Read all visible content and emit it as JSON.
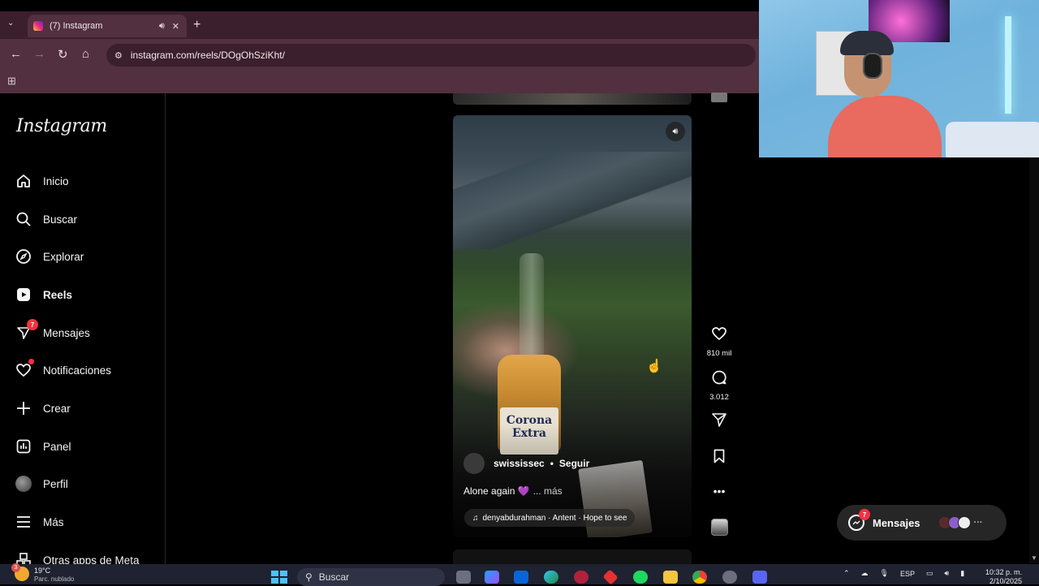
{
  "browser": {
    "tab_title": "(7) Instagram",
    "url": "instagram.com/reels/DOgOhSziKht/",
    "icons": [
      "tab-search-icon",
      "audio-icon",
      "close-icon",
      "new-tab-icon",
      "back-icon",
      "forward-icon",
      "reload-icon",
      "home-icon",
      "site-info-icon",
      "apps-icon"
    ]
  },
  "sidebar": {
    "logo": "Instagram",
    "items": [
      {
        "label": "Inicio",
        "icon": "home-icon"
      },
      {
        "label": "Buscar",
        "icon": "search-icon"
      },
      {
        "label": "Explorar",
        "icon": "compass-icon"
      },
      {
        "label": "Reels",
        "icon": "reels-icon"
      },
      {
        "label": "Mensajes",
        "icon": "messenger-icon",
        "badge": "7"
      },
      {
        "label": "Notificaciones",
        "icon": "heart-icon"
      },
      {
        "label": "Crear",
        "icon": "plus-icon"
      },
      {
        "label": "Panel",
        "icon": "dashboard-icon"
      },
      {
        "label": "Perfil",
        "icon": "avatar"
      },
      {
        "label": "Más",
        "icon": "menu-icon"
      },
      {
        "label": "Otras apps de Meta",
        "icon": "meta-apps-icon"
      }
    ]
  },
  "reel": {
    "username": "swississec",
    "separator": "•",
    "follow": "Seguir",
    "caption": "Alone again 💜",
    "more": "... más",
    "music": "denyabdurahman · Antent · Hope to see",
    "bottle_label": "Corona Extra"
  },
  "actions": {
    "likes": "810 mil",
    "comments": "3.012"
  },
  "messages_pill": {
    "label": "Mensajes",
    "badge": "7"
  },
  "taskbar": {
    "temperature": "19°C",
    "condition": "Parc. nublado",
    "weather_badge": "3",
    "search_placeholder": "Buscar",
    "language": "ESP",
    "time": "10:32 p. m.",
    "date": "2/10/2025"
  },
  "colors": {
    "chrome_frame": "#3b1f2c",
    "chrome_toolbar": "#52303f",
    "notification_red": "#ff3040",
    "background": "#000000"
  }
}
